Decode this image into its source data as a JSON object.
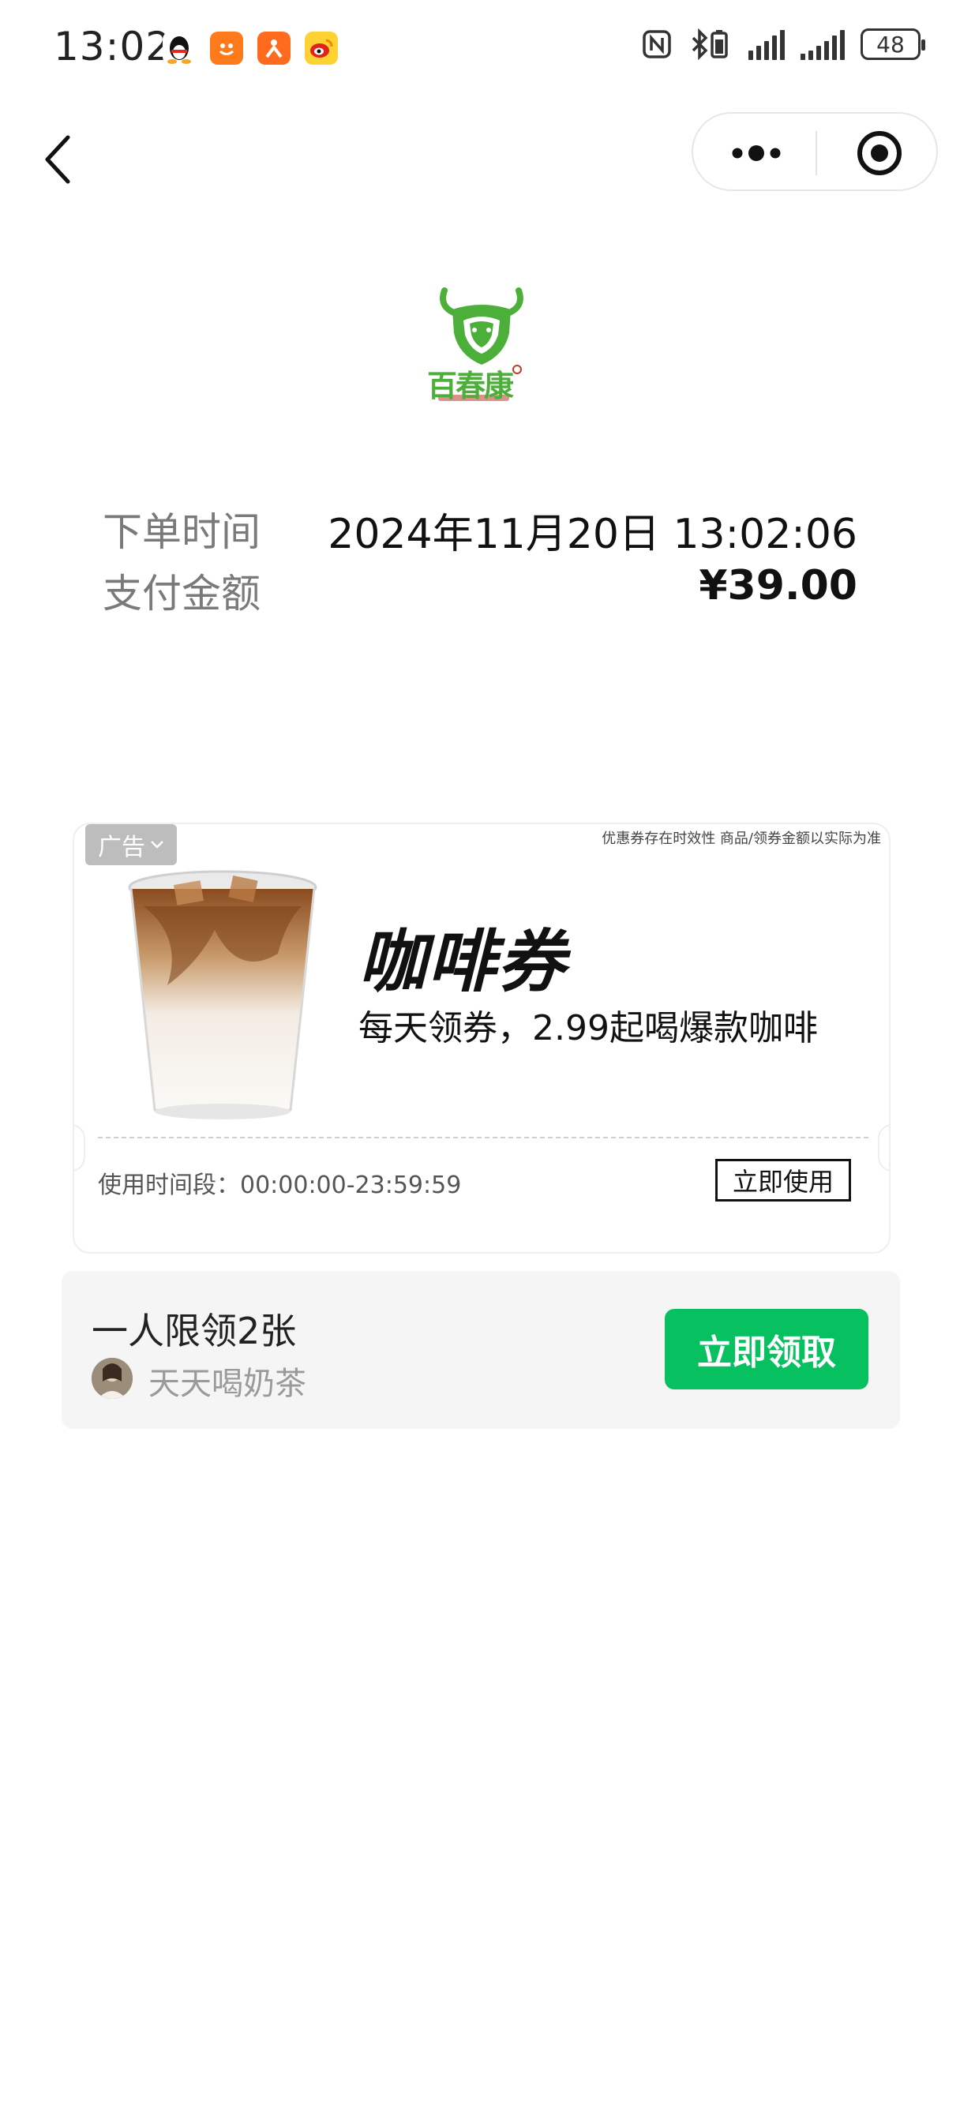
{
  "status_bar": {
    "time": "13:02",
    "battery": "48",
    "apps": [
      "qq-icon",
      "taobao-icon",
      "app-icon",
      "weibo-icon"
    ]
  },
  "nav": {
    "back_icon": "chevron-left-icon",
    "more_icon": "more-dots-icon",
    "close_icon": "target-close-icon"
  },
  "merchant": {
    "logo_text": "百春康"
  },
  "order": {
    "time_label": "下单时间",
    "time_value": "2024年11月20日 13:02:06",
    "amount_label": "支付金额",
    "amount_value": "¥39.00"
  },
  "ad": {
    "tag": "广告",
    "disclaimer": "优惠券存在时效性 商品/领券金额以实际为准",
    "title": "咖啡券",
    "subtitle": "每天领券，2.99起喝爆款咖啡",
    "use_time": "使用时间段：00:00:00-23:59:59",
    "use_button": "立即使用"
  },
  "claim": {
    "limit": "一人限领2张",
    "publisher": "天天喝奶茶",
    "button": "立即领取"
  },
  "colors": {
    "accent_green": "#07c160",
    "logo_green": "#4caf3a"
  }
}
